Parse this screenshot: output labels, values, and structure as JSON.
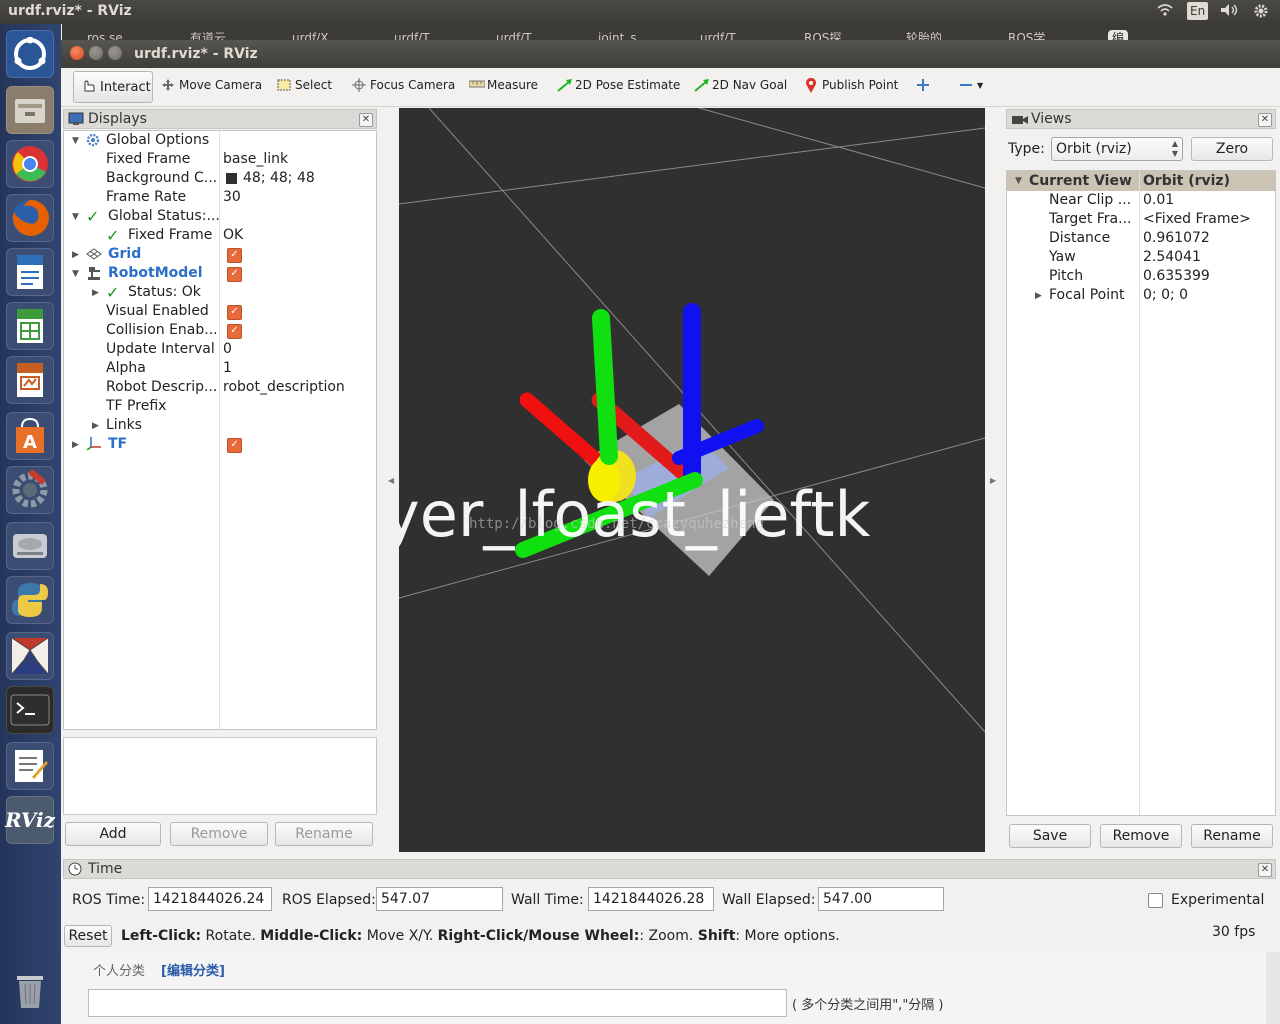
{
  "top_panel": {
    "title": "urdf.rviz* - RViz",
    "keyboard": "En"
  },
  "tab_hints": [
    "ros.se",
    "有道云",
    "urdf/X",
    "urdf/T",
    "urdf/T",
    "joint_s",
    "urdf/T",
    "ROS探",
    "轮胎的",
    "ROS学",
    "编"
  ],
  "window": {
    "title": "urdf.rviz* - RViz"
  },
  "toolbar": {
    "interact": "Interact",
    "move_camera": "Move Camera",
    "select": "Select",
    "focus_camera": "Focus Camera",
    "measure": "Measure",
    "pose_estimate": "2D Pose Estimate",
    "nav_goal": "2D Nav Goal",
    "publish_point": "Publish Point"
  },
  "displays": {
    "title": "Displays",
    "rows": [
      {
        "label": "Global Options",
        "value": ""
      },
      {
        "label": "Fixed Frame",
        "value": "base_link"
      },
      {
        "label": "Background C...",
        "value": "48; 48; 48"
      },
      {
        "label": "Frame Rate",
        "value": "30"
      },
      {
        "label": "Global Status:...",
        "value": ""
      },
      {
        "label": "Fixed Frame",
        "value": "OK"
      },
      {
        "label": "Grid",
        "value": ""
      },
      {
        "label": "RobotModel",
        "value": ""
      },
      {
        "label": "Status: Ok",
        "value": ""
      },
      {
        "label": "Visual Enabled",
        "value": ""
      },
      {
        "label": "Collision Enab...",
        "value": ""
      },
      {
        "label": "Update Interval",
        "value": "0"
      },
      {
        "label": "Alpha",
        "value": "1"
      },
      {
        "label": "Robot Descrip...",
        "value": "robot_description"
      },
      {
        "label": "TF Prefix",
        "value": ""
      },
      {
        "label": "Links",
        "value": ""
      },
      {
        "label": "TF",
        "value": ""
      }
    ],
    "buttons": {
      "add": "Add",
      "remove": "Remove",
      "rename": "Rename"
    }
  },
  "viewport": {
    "overlay_text": "yer_lfoast_lieftk",
    "watermark": "http://blog.csdn.net/crazyquhezheng"
  },
  "views": {
    "title": "Views",
    "type_label": "Type:",
    "type_value": "Orbit (rviz)",
    "zero": "Zero",
    "header_left": "Current View",
    "header_right": "Orbit (rviz)",
    "rows": [
      {
        "label": "Near Clip ...",
        "value": "0.01"
      },
      {
        "label": "Target Fra...",
        "value": "<Fixed Frame>"
      },
      {
        "label": "Distance",
        "value": "0.961072"
      },
      {
        "label": "Yaw",
        "value": "2.54041"
      },
      {
        "label": "Pitch",
        "value": "0.635399"
      },
      {
        "label": "Focal Point",
        "value": "0; 0; 0"
      }
    ],
    "buttons": {
      "save": "Save",
      "remove": "Remove",
      "rename": "Rename"
    }
  },
  "time": {
    "title": "Time",
    "ros_time_label": "ROS Time:",
    "ros_time": "1421844026.24",
    "ros_elapsed_label": "ROS Elapsed:",
    "ros_elapsed": "547.07",
    "wall_time_label": "Wall Time:",
    "wall_time": "1421844026.28",
    "wall_elapsed_label": "Wall Elapsed:",
    "wall_elapsed": "547.00",
    "experimental": "Experimental"
  },
  "status": {
    "reset": "Reset",
    "b1": "Left-Click:",
    "t1": " Rotate. ",
    "b2": "Middle-Click:",
    "t2": " Move X/Y. ",
    "b3": "Right-Click/Mouse Wheel:",
    "t3": ": Zoom. ",
    "b4": "Shift",
    "t4": ": More options.",
    "fps": "30 fps"
  },
  "below": {
    "category_label": "个人分类",
    "edit_category": "[编辑分类]",
    "hint": "( 多个分类之间用\",\"分隔 )"
  },
  "colors": {
    "viewport_bg": "#303030",
    "accent": "#e8693a",
    "link_blue": "#2a6fc9"
  }
}
